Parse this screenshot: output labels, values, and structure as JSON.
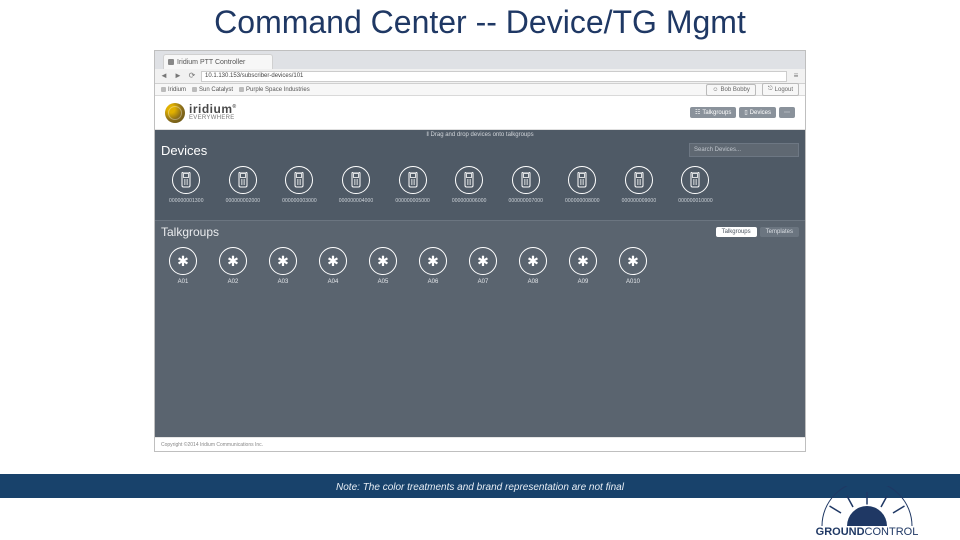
{
  "slide": {
    "title": "Command Center -- Device/TG Mgmt",
    "footnote": "Note: The color treatments and brand representation are not final"
  },
  "browser": {
    "tab_title": "Iridium PTT Controller",
    "url": "10.1.130.153/subscriber-devices/101",
    "bookmarks": [
      "Iridium",
      "Sun Catalyst",
      "Purple Space Industries"
    ],
    "user_label": "Bob Bobby",
    "logout_label": "Logout"
  },
  "brand": {
    "name": "iridium",
    "tagline": "EVERYWHERE"
  },
  "nav_tabs": {
    "talkgroups": "Talkgroups",
    "devices": "Devices"
  },
  "hint": "‖ Drag and drop devices onto talkgroups",
  "devices_section": {
    "title": "Devices",
    "search_placeholder": "Search Devices...",
    "items": [
      {
        "label": "000000001300"
      },
      {
        "label": "000000002000"
      },
      {
        "label": "000000003000"
      },
      {
        "label": "000000004000"
      },
      {
        "label": "000000005000"
      },
      {
        "label": "000000006000"
      },
      {
        "label": "000000007000"
      },
      {
        "label": "000000008000"
      },
      {
        "label": "000000009000"
      },
      {
        "label": "000000010000"
      }
    ]
  },
  "talkgroups_section": {
    "title": "Talkgroups",
    "tabs": {
      "talkgroups": "Talkgroups",
      "templates": "Templates"
    },
    "items": [
      {
        "label": "A01"
      },
      {
        "label": "A02"
      },
      {
        "label": "A03"
      },
      {
        "label": "A04"
      },
      {
        "label": "A05"
      },
      {
        "label": "A06"
      },
      {
        "label": "A07"
      },
      {
        "label": "A08"
      },
      {
        "label": "A09"
      },
      {
        "label": "A010"
      }
    ]
  },
  "copyright": "Copyright ©2014 Iridium Communications Inc.",
  "footer_brand": {
    "line1": "GROUND",
    "line2": "CONTROL"
  }
}
